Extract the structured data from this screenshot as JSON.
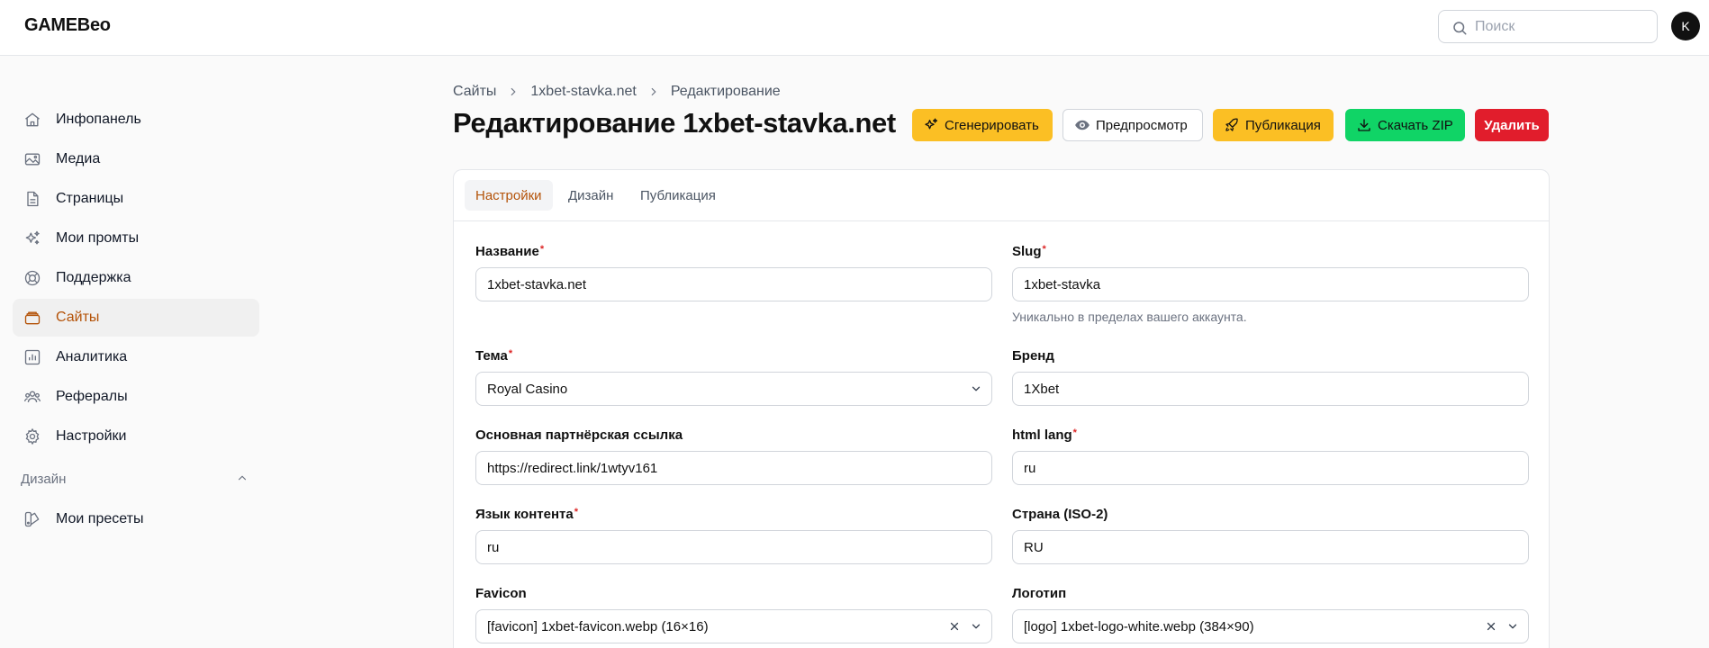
{
  "app": {
    "name": "GAMEBeo"
  },
  "search": {
    "placeholder": "Поиск"
  },
  "user": {
    "initial": "K"
  },
  "sidebar": {
    "items": [
      {
        "label": "Инфопанель",
        "icon": "home-icon"
      },
      {
        "label": "Медиа",
        "icon": "image-icon"
      },
      {
        "label": "Страницы",
        "icon": "file-icon"
      },
      {
        "label": "Мои промты",
        "icon": "sparkles-icon"
      },
      {
        "label": "Поддержка",
        "icon": "lifebuoy-icon"
      },
      {
        "label": "Сайты",
        "icon": "stack-icon",
        "active": true
      },
      {
        "label": "Аналитика",
        "icon": "chart-icon"
      },
      {
        "label": "Рефералы",
        "icon": "users-icon"
      },
      {
        "label": "Настройки",
        "icon": "gear-icon"
      }
    ],
    "design_section": {
      "title": "Дизайн",
      "items": [
        {
          "label": "Мои пресеты",
          "icon": "palette-icon"
        }
      ]
    }
  },
  "breadcrumb": [
    "Сайты",
    "1xbet-stavka.net",
    "Редактирование"
  ],
  "page": {
    "title": "Редактирование 1xbet-stavka.net"
  },
  "actions": {
    "generate": "Сгенерировать",
    "preview": "Предпросмотр",
    "publish": "Публикация",
    "download_zip": "Скачать ZIP",
    "delete": "Удалить"
  },
  "tabs": [
    "Настройки",
    "Дизайн",
    "Публикация"
  ],
  "active_tab": "Настройки",
  "form": {
    "name": {
      "label": "Название",
      "value": "1xbet-stavka.net"
    },
    "slug": {
      "label": "Slug",
      "value": "1xbet-stavka",
      "hint": "Уникально в пределах вашего аккаунта."
    },
    "theme": {
      "label": "Тема",
      "value": "Royal Casino"
    },
    "brand": {
      "label": "Бренд",
      "value": "1Xbet"
    },
    "affiliate_link": {
      "label": "Основная партнёрская ссылка",
      "value": "https://redirect.link/1wtyv161"
    },
    "html_lang": {
      "label": "html lang",
      "value": "ru"
    },
    "content_lang": {
      "label": "Язык контента",
      "value": "ru"
    },
    "country": {
      "label": "Страна (ISO-2)",
      "value": "RU"
    },
    "favicon": {
      "label": "Favicon",
      "value": "[favicon] 1xbet-favicon.webp (16×16)"
    },
    "logo": {
      "label": "Логотип",
      "value": "[logo] 1xbet-logo-white.webp (384×90)"
    }
  },
  "colors": {
    "accent": "#b45309",
    "primary_button": "#fbbf24",
    "zip_button": "#10d466",
    "delete_button": "#e11d2c",
    "required_mark": "#dc2626"
  }
}
